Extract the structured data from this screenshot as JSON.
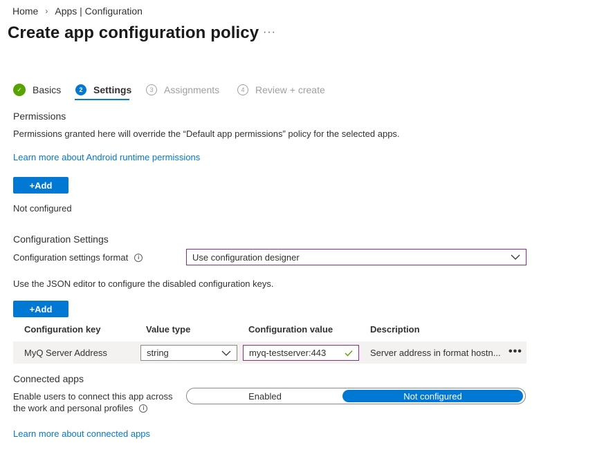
{
  "breadcrumb": {
    "home": "Home",
    "current": "Apps | Configuration",
    "sep": "›"
  },
  "page": {
    "title": "Create app configuration policy",
    "more": "···"
  },
  "wizard": {
    "steps": [
      {
        "num": "✓",
        "label": "Basics",
        "state": "done"
      },
      {
        "num": "2",
        "label": "Settings",
        "state": "active"
      },
      {
        "num": "3",
        "label": "Assignments",
        "state": "future"
      },
      {
        "num": "4",
        "label": "Review + create",
        "state": "future"
      }
    ]
  },
  "permissions": {
    "heading": "Permissions",
    "description": "Permissions granted here will override the “Default app permissions” policy for the selected apps.",
    "learn_link": "Learn more about Android runtime permissions",
    "add_label": "+Add",
    "status": "Not configured"
  },
  "config": {
    "heading": "Configuration Settings",
    "format_label": "Configuration settings format",
    "format_value": "Use configuration designer",
    "json_note": "Use the JSON editor to configure the disabled configuration keys.",
    "add_label": "+Add",
    "columns": [
      "Configuration key",
      "Value type",
      "Configuration value",
      "Description"
    ],
    "rows": [
      {
        "key": "MyQ Server Address",
        "type": "string",
        "value": "myq-testserver:443",
        "description": "Server address in format hostn..."
      }
    ]
  },
  "connected": {
    "heading": "Connected apps",
    "label_line1": "Enable users to connect this app across",
    "label_line2": "the work and personal profiles",
    "options": [
      "Enabled",
      "Not configured"
    ],
    "selected": "Not configured",
    "learn_link": "Learn more about connected apps"
  },
  "colors": {
    "accent": "#0078d4",
    "success": "#57a300",
    "focus_border": "#8a2b8f"
  }
}
